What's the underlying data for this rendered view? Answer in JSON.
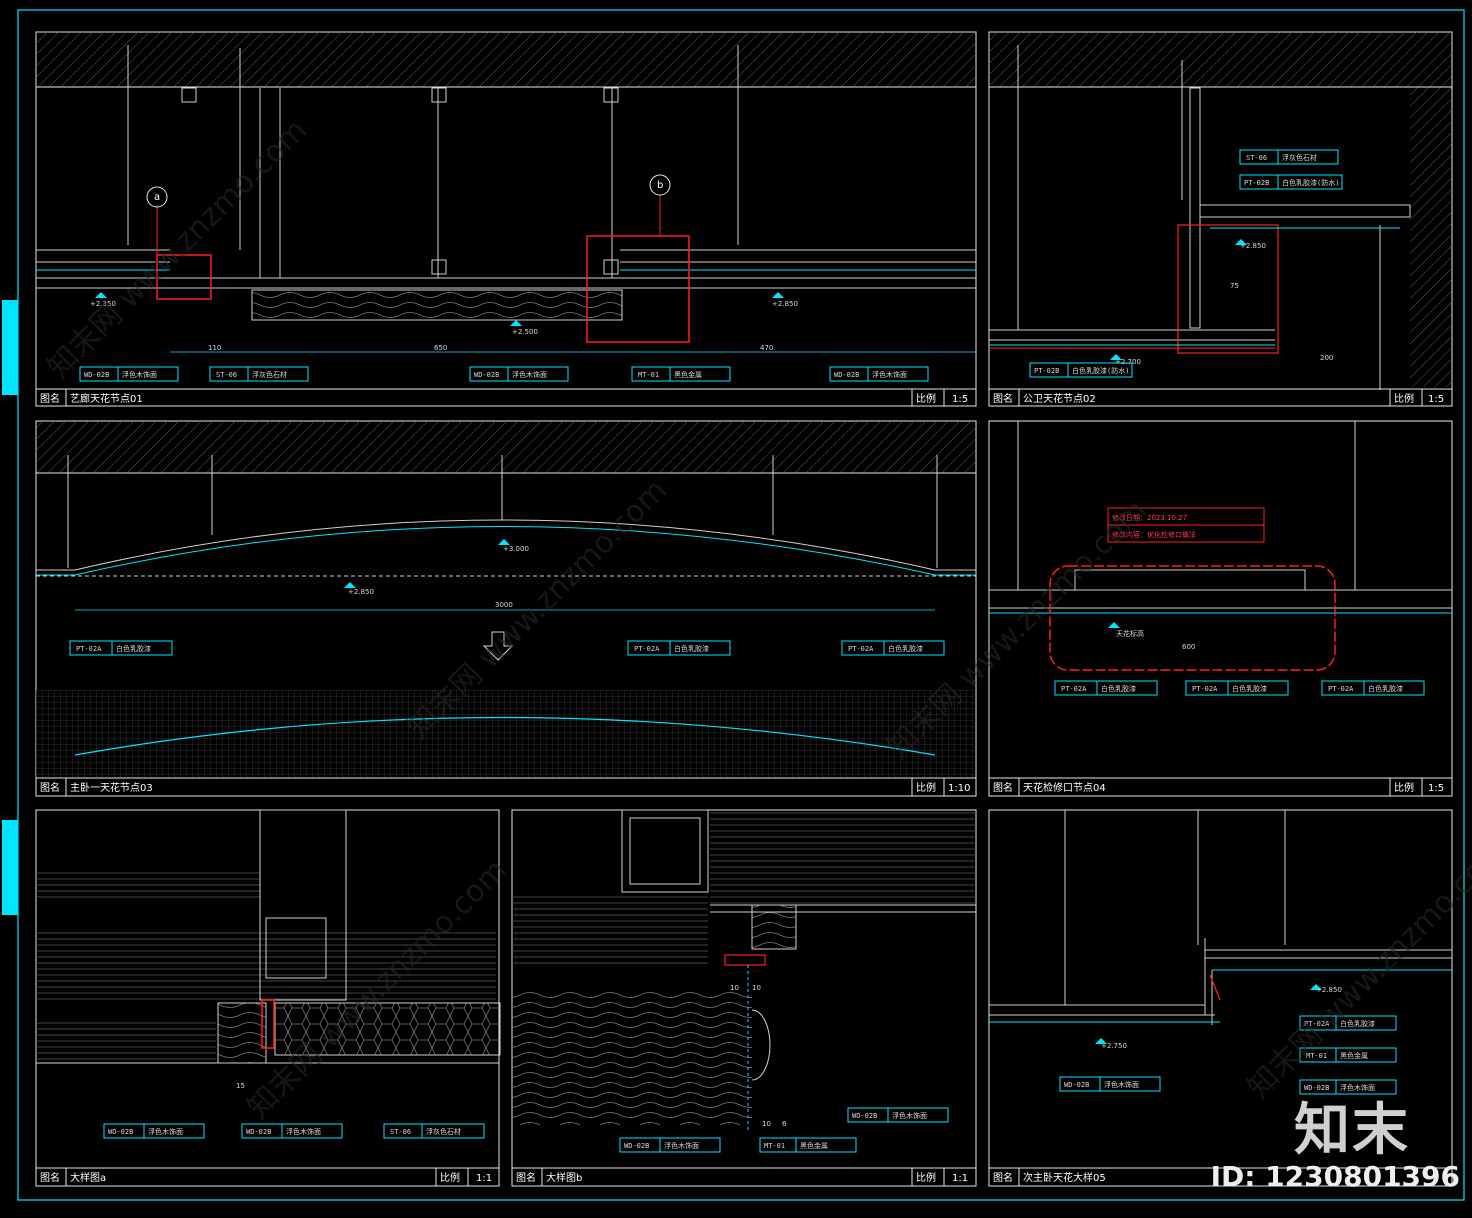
{
  "colors": {
    "background": "#000000",
    "frame": "#00e5ff",
    "line": "#e6e6e6",
    "highlight": "#ff2020",
    "accent_tab": "#00e5ff"
  },
  "panels": [
    {
      "title_prefix": "图名",
      "title": "艺廊天花节点01",
      "scale_label": "比例",
      "scale": "1:5"
    },
    {
      "title_prefix": "图名",
      "title": "公卫天花节点02",
      "scale_label": "比例",
      "scale": "1:5"
    },
    {
      "title_prefix": "图名",
      "title": "主卧一天花节点03",
      "scale_label": "比例",
      "scale": "1:10"
    },
    {
      "title_prefix": "图名",
      "title": "天花检修口节点04",
      "scale_label": "比例",
      "scale": "1:5"
    },
    {
      "title_prefix": "图名",
      "title": "大样图a",
      "scale_label": "比例",
      "scale": "1:1"
    },
    {
      "title_prefix": "图名",
      "title": "大样图b",
      "scale_label": "比例",
      "scale": "1:1"
    },
    {
      "title_prefix": "图名",
      "title": "次主卧天花大样05",
      "scale_label": "比例",
      "scale": "1:5"
    }
  ],
  "annotations": {
    "p1": {
      "callout_a": "a",
      "callout_b": "b",
      "levels": [
        "+2.350",
        "+2.500",
        "+2.850"
      ],
      "dims": [
        "110",
        "650",
        "470"
      ],
      "tags": [
        {
          "code": "WD-02B",
          "text": "浮色木饰面"
        },
        {
          "code": "ST-06",
          "text": "浮灰色石材"
        },
        {
          "code": "WD-02B",
          "text": "浮色木饰面"
        },
        {
          "code": "MT-01",
          "text": "黑色金属"
        },
        {
          "code": "WD-02B",
          "text": "浮色木饰面"
        }
      ]
    },
    "p2": {
      "levels": [
        "+2.850",
        "+2.700"
      ],
      "tags": [
        {
          "code": "ST-06",
          "text": "浮灰色石材"
        },
        {
          "code": "PT-02B",
          "text": "白色乳胶漆(防水)"
        },
        {
          "code": "PT-02B",
          "text": "白色乳胶漆(防水)"
        }
      ],
      "dims": [
        "75",
        "200"
      ]
    },
    "p3": {
      "levels": [
        "+3.000",
        "+2.850"
      ],
      "dim_length": "3000",
      "tags": [
        {
          "code": "PT-02A",
          "text": "白色乳胶漆"
        },
        {
          "code": "PT-02A",
          "text": "白色乳胶漆"
        },
        {
          "code": "PT-02A",
          "text": "白色乳胶漆"
        }
      ]
    },
    "p4": {
      "revision_date": "修改日期：2023.10.27",
      "revision_content": "修改内容：优化检修口做法",
      "label_ceiling": "天花标高",
      "dim": "600",
      "tags": [
        {
          "code": "PT-02A",
          "text": "白色乳胶漆"
        },
        {
          "code": "PT-02A",
          "text": "白色乳胶漆"
        },
        {
          "code": "PT-02A",
          "text": "白色乳胶漆"
        }
      ]
    },
    "p5": {
      "tags": [
        {
          "code": "WD-02B",
          "text": "浮色木饰面"
        },
        {
          "code": "WD-02B",
          "text": "浮色木饰面"
        },
        {
          "code": "ST-06",
          "text": "浮灰色石材"
        }
      ],
      "dim": "15"
    },
    "p6": {
      "tags": [
        {
          "code": "WD-02B",
          "text": "浮色木饰面"
        },
        {
          "code": "MT-01",
          "text": "黑色金属"
        },
        {
          "code": "WD-02B",
          "text": "浮色木饰面"
        }
      ],
      "dims": [
        "10",
        "10",
        "10",
        "6"
      ]
    },
    "p7": {
      "levels": [
        "+2.850",
        "+2.750"
      ],
      "tags": [
        {
          "code": "PT-02A",
          "text": "白色乳胶漆"
        },
        {
          "code": "MT-01",
          "text": "黑色金属"
        },
        {
          "code": "WD-02B",
          "text": "浮色木饰面"
        },
        {
          "code": "WD-02B",
          "text": "浮色木饰面"
        }
      ]
    }
  },
  "watermark": "知末网 www.znzmo.com",
  "brand": "知末",
  "image_id": "ID: 1230801396"
}
